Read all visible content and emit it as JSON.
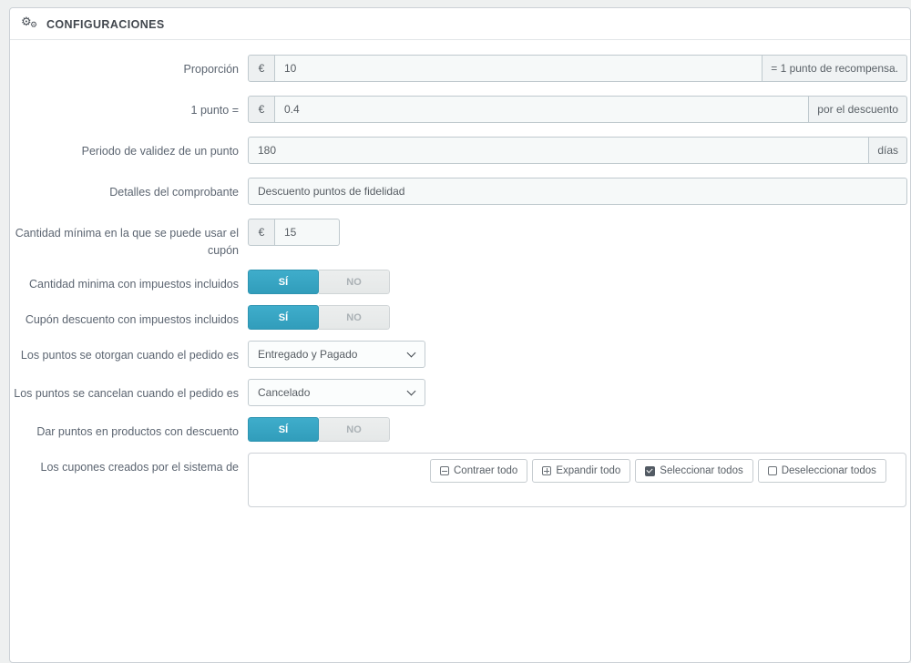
{
  "header": {
    "title": "CONFIGURACIONES"
  },
  "switch_labels": {
    "yes": "SÍ",
    "no": "NO"
  },
  "rows": {
    "proportion": {
      "label": "Proporción",
      "prefix": "€",
      "value": "10",
      "suffix": "= 1 punto de recompensa."
    },
    "point_value": {
      "label": "1 punto =",
      "prefix": "€",
      "value": "0.4",
      "suffix": "por el descuento"
    },
    "validity": {
      "label": "Periodo de validez de un punto",
      "value": "180",
      "suffix": "días"
    },
    "voucher_details": {
      "label": "Detalles del comprobante",
      "value": "Descuento puntos de fidelidad"
    },
    "min_amount": {
      "label": "Cantidad mínima en la que se puede usar el cupón",
      "prefix": "€",
      "value": "15"
    },
    "min_amount_tax": {
      "label": "Cantidad minima con impuestos incluidos",
      "state": "SÍ"
    },
    "voucher_tax": {
      "label": "Cupón descuento con impuestos incluidos",
      "state": "SÍ"
    },
    "points_awarded": {
      "label": "Los puntos se otorgan cuando el pedido es",
      "value": "Entregado y Pagado"
    },
    "points_cancelled": {
      "label": "Los puntos se cancelan cuando el pedido es",
      "value": "Cancelado"
    },
    "discounted_products": {
      "label": "Dar puntos en productos con descuento",
      "state": "SÍ"
    },
    "categories": {
      "label": "Los cupones creados por el sistema de"
    }
  },
  "tree_toolbar": {
    "collapse_all": "Contraer todo",
    "expand_all": "Expandir todo",
    "check_all": "Seleccionar todos",
    "uncheck_all": "Deseleccionar todos"
  },
  "colors": {
    "accent": "#36a5c4",
    "panel_bg": "#ffffff",
    "page_bg": "#eef0f0"
  }
}
